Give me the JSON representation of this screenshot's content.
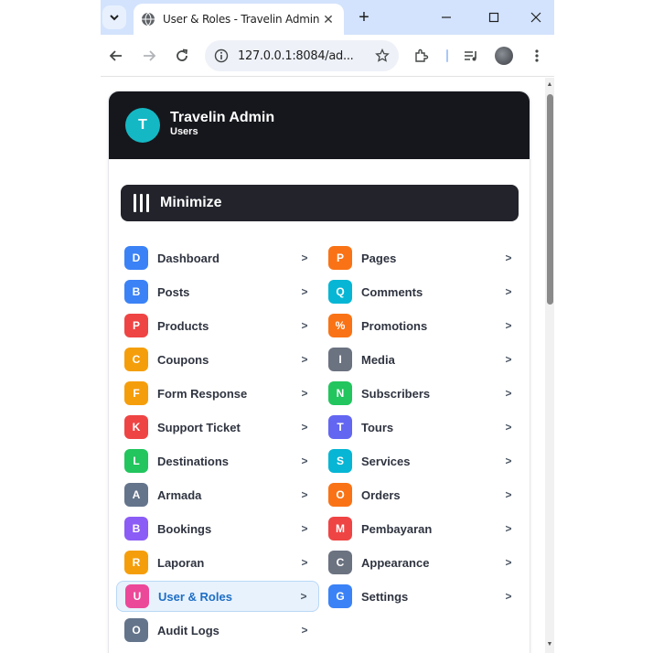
{
  "browser": {
    "tab_title": "User & Roles - Travelin Admin",
    "url": "127.0.0.1:8084/ad...",
    "new_tab_label": "+",
    "close_tab_label": "✕"
  },
  "header": {
    "avatar_letter": "T",
    "title": "Travelin Admin",
    "subtitle": "Users"
  },
  "minimize_label": "Minimize",
  "chevron": ">",
  "menu": {
    "left": [
      {
        "letter": "D",
        "label": "Dashboard",
        "color": "#3b82f6"
      },
      {
        "letter": "B",
        "label": "Posts",
        "color": "#3b82f6"
      },
      {
        "letter": "P",
        "label": "Products",
        "color": "#ef4444"
      },
      {
        "letter": "C",
        "label": "Coupons",
        "color": "#f59e0b"
      },
      {
        "letter": "F",
        "label": "Form Response",
        "color": "#f59e0b"
      },
      {
        "letter": "K",
        "label": "Support Ticket",
        "color": "#ef4444"
      },
      {
        "letter": "L",
        "label": "Destinations",
        "color": "#22c55e"
      },
      {
        "letter": "A",
        "label": "Armada",
        "color": "#64748b"
      },
      {
        "letter": "B",
        "label": "Bookings",
        "color": "#8b5cf6"
      },
      {
        "letter": "R",
        "label": "Laporan",
        "color": "#f59e0b"
      },
      {
        "letter": "U",
        "label": "User & Roles",
        "color": "#ec4899",
        "active": true
      },
      {
        "letter": "O",
        "label": "Audit Logs",
        "color": "#64748b"
      }
    ],
    "right": [
      {
        "letter": "P",
        "label": "Pages",
        "color": "#f97316"
      },
      {
        "letter": "Q",
        "label": "Comments",
        "color": "#06b6d4"
      },
      {
        "letter": "%",
        "label": "Promotions",
        "color": "#f97316"
      },
      {
        "letter": "I",
        "label": "Media",
        "color": "#6b7280"
      },
      {
        "letter": "N",
        "label": "Subscribers",
        "color": "#22c55e"
      },
      {
        "letter": "T",
        "label": "Tours",
        "color": "#6366f1"
      },
      {
        "letter": "S",
        "label": "Services",
        "color": "#06b6d4"
      },
      {
        "letter": "O",
        "label": "Orders",
        "color": "#f97316"
      },
      {
        "letter": "M",
        "label": "Pembayaran",
        "color": "#ef4444"
      },
      {
        "letter": "C",
        "label": "Appearance",
        "color": "#6b7280"
      },
      {
        "letter": "G",
        "label": "Settings",
        "color": "#3b82f6"
      }
    ]
  }
}
